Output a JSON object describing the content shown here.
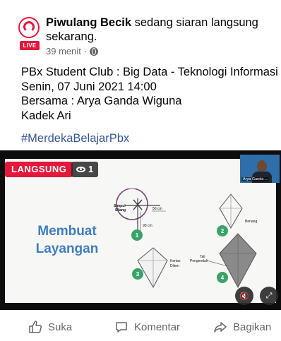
{
  "post": {
    "page_name": "Piwulang Becik",
    "status_text": " sedang siaran langsung sekarang.",
    "time": "39 menit",
    "time_sep": "·",
    "avatar_badge": "LIVE",
    "lines": [
      "PBx Student Club : Big Data - Teknologi Informasi",
      "Senin, 07 Juni 2021 14:00",
      "Bersama : Arya Ganda Wiguna",
      "Kadek Ari"
    ],
    "hashtag": "#MerdekaBelajarPbx"
  },
  "video": {
    "live_label": "LANGSUNG",
    "viewer_count": "1",
    "camera_label": "Arya Ganda ...",
    "slide": {
      "title_line1": "Membuat",
      "title_line2": "Layangan",
      "step_numbers": [
        "1",
        "2",
        "3",
        "4"
      ],
      "labels": {
        "simpul": "Simpul",
        "silang": "Silang",
        "cm50": "50 cm",
        "cm90": "90 cm",
        "benang": "Benang",
        "kertas": "Kertas",
        "dilem": "Dilem",
        "tali": "Tali",
        "pengendali": "Pengendali"
      }
    }
  },
  "actions": {
    "like": "Suka",
    "comment": "Komentar",
    "share": "Bagikan"
  }
}
